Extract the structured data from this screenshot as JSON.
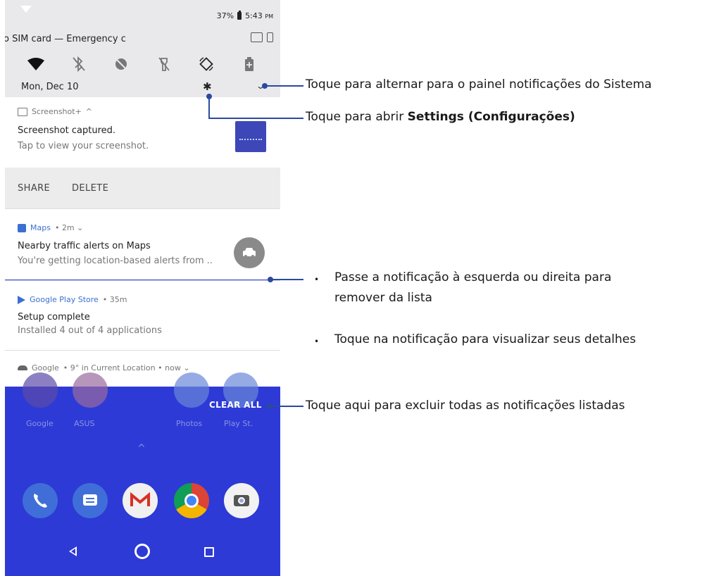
{
  "status_bar": {
    "battery": "37%",
    "time": "5:43",
    "ampm": "PM"
  },
  "quick_settings": {
    "carrier": "o SIM card — Emergency c",
    "date": "Mon, Dec 10",
    "tiles": [
      "wifi-icon",
      "bluetooth-off-icon",
      "do-not-disturb-icon",
      "flashlight-off-icon",
      "auto-rotate-icon",
      "battery-saver-icon"
    ]
  },
  "notifications": [
    {
      "app": "Screenshot+",
      "app_suffix": "^",
      "title": "Screenshot captured.",
      "text": "Tap to view your screenshot.",
      "actions": [
        "SHARE",
        "DELETE"
      ]
    },
    {
      "app": "Maps",
      "meta": "• 2m ⌄",
      "title": "Nearby traffic alerts on Maps",
      "text": "You're getting location-based alerts from .."
    },
    {
      "app": "Google Play Store",
      "meta": "• 35m",
      "title": "Setup complete",
      "text": "Installed 4 out of 4 applications"
    },
    {
      "app": "Google",
      "meta": "• 9° in Current Location • now ⌄"
    }
  ],
  "home": {
    "app_labels": [
      "Google",
      "ASUS",
      "Photos",
      "Play St."
    ],
    "clear_all": "CLEAR ALL"
  },
  "annotations": {
    "toggle_panel": "Toque para alternar para o painel notificações do Sistema",
    "open_settings_prefix": "Toque para abrir ",
    "open_settings_bold": "Settings (Configurações)",
    "swipe_line1": "Passe a notificação à esquerda ou direita para",
    "swipe_line2": "remover da lista",
    "tap_details": "Toque na notificação para visualizar seus detalhes",
    "clear_all": "Toque aqui para excluir todas as notificações listadas",
    "bullet": "•"
  },
  "colors": {
    "accent_line": "#2a4aa0",
    "home_bg": "#2d3ad6"
  }
}
